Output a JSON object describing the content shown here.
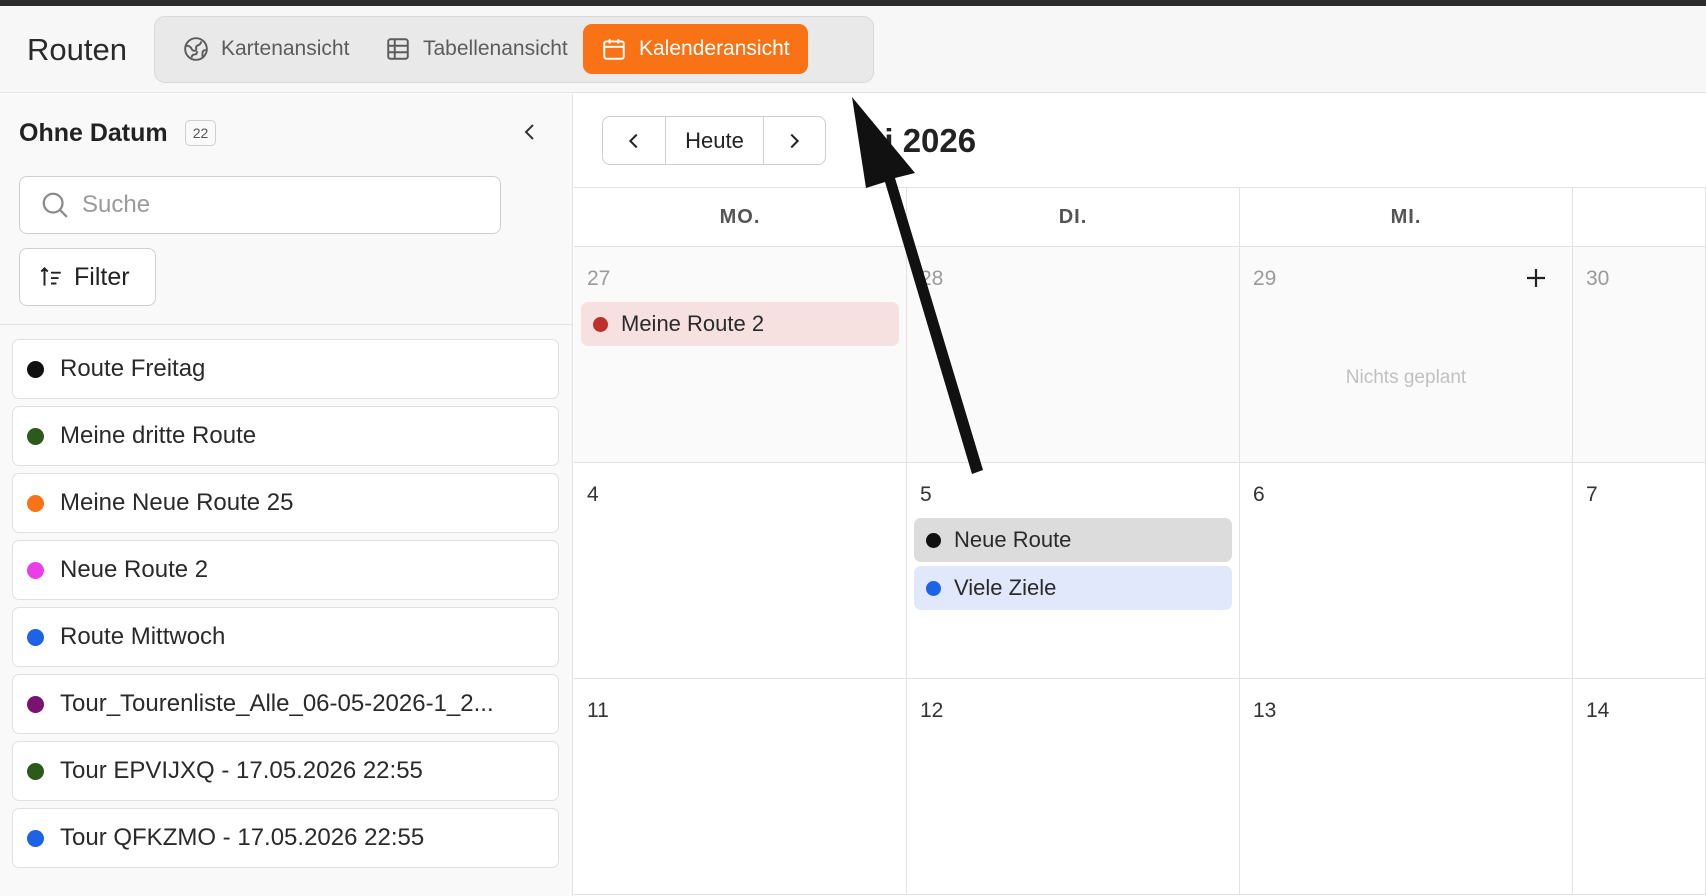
{
  "header": {
    "title": "Routen",
    "views": [
      {
        "label": "Kartenansicht",
        "icon": "globe-icon",
        "active": false
      },
      {
        "label": "Tabellenansicht",
        "icon": "table-icon",
        "active": false
      },
      {
        "label": "Kalenderansicht",
        "icon": "calendar-icon",
        "active": true
      }
    ],
    "accent_color": "#f97316"
  },
  "sidebar": {
    "title": "Ohne Datum",
    "count": "22",
    "search_placeholder": "Suche",
    "filter_label": "Filter",
    "routes": [
      {
        "name": "Route Freitag",
        "color": "#111111"
      },
      {
        "name": "Meine dritte Route",
        "color": "#2d5a1b"
      },
      {
        "name": "Meine Neue Route 25",
        "color": "#f97316"
      },
      {
        "name": "Neue Route 2",
        "color": "#e83fe8"
      },
      {
        "name": "Route Mittwoch",
        "color": "#1d63e6"
      },
      {
        "name": "Tour_Tourenliste_Alle_06-05-2026-1_2...",
        "color": "#7a1370"
      },
      {
        "name": "Tour EPVIJXQ - 17.05.2026 22:55",
        "color": "#2d5a1b"
      },
      {
        "name": "Tour QFKZMO - 17.05.2026 22:55",
        "color": "#1d63e6"
      }
    ]
  },
  "calendar": {
    "nav": {
      "prev": "‹",
      "today": "Heute",
      "next": "›"
    },
    "month_title": "ai 2026",
    "weekdays": [
      "MO.",
      "DI.",
      "MI.",
      ""
    ],
    "weeks": [
      {
        "days": [
          {
            "num": "27",
            "muted": true,
            "events": [
              {
                "name": "Meine Route 2",
                "color": "#c0302a",
                "bg": "#f6e0e0"
              }
            ]
          },
          {
            "num": "28",
            "muted": true,
            "events": []
          },
          {
            "num": "29",
            "muted": true,
            "events": [],
            "note": "Nichts geplant",
            "add": true
          },
          {
            "num": "30",
            "muted": true,
            "events": []
          }
        ]
      },
      {
        "days": [
          {
            "num": "4",
            "muted": false,
            "events": []
          },
          {
            "num": "5",
            "muted": false,
            "events": [
              {
                "name": "Neue Route",
                "color": "#111111",
                "bg": "#dcdcdc"
              },
              {
                "name": "Viele Ziele",
                "color": "#1d63e6",
                "bg": "#e1e8fb"
              }
            ]
          },
          {
            "num": "6",
            "muted": false,
            "events": []
          },
          {
            "num": "7",
            "muted": false,
            "events": []
          }
        ]
      },
      {
        "days": [
          {
            "num": "11",
            "muted": false,
            "events": []
          },
          {
            "num": "12",
            "muted": false,
            "events": []
          },
          {
            "num": "13",
            "muted": false,
            "events": []
          },
          {
            "num": "14",
            "muted": false,
            "events": []
          }
        ]
      }
    ]
  }
}
